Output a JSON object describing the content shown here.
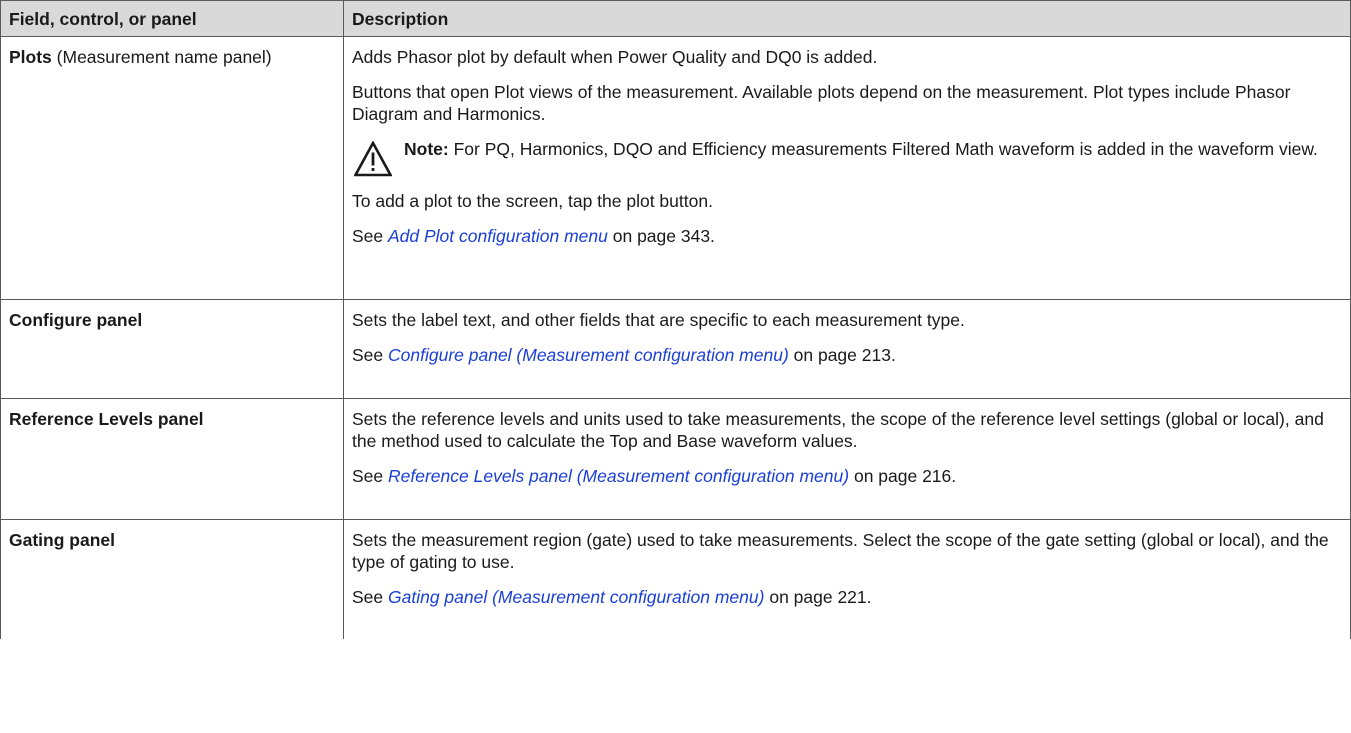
{
  "table": {
    "headers": [
      "Field, control, or panel",
      "Description"
    ],
    "rows": [
      {
        "field_bold": "Plots",
        "field_rest": " (Measurement name panel)",
        "paragraphs": [
          "Adds Phasor plot by default when Power Quality and DQ0 is added.",
          "Buttons that open Plot views of the measurement. Available plots depend on the measurement. Plot types include Phasor Diagram and Harmonics."
        ],
        "note": {
          "label": "Note:",
          "text": " For PQ, Harmonics, DQO and Efficiency measurements Filtered Math waveform is added in the waveform view."
        },
        "paragraphs_after": [
          "To add a plot to the screen, tap the plot button."
        ],
        "see": {
          "prefix": "See ",
          "link": "Add Plot configuration menu",
          "suffix": " on page 343."
        }
      },
      {
        "field_bold": "Configure panel",
        "paragraphs": [
          "Sets the label text, and other fields that are specific to each measurement type."
        ],
        "see": {
          "prefix": "See ",
          "link": "Configure panel (Measurement configuration menu)",
          "suffix": " on page 213."
        }
      },
      {
        "field_bold": "Reference Levels panel",
        "paragraphs": [
          "Sets the reference levels and units used to take measurements, the scope of the reference level settings (global or local), and the method used to calculate the Top and Base waveform values."
        ],
        "see": {
          "prefix": "See ",
          "link": "Reference Levels panel (Measurement configuration menu)",
          "suffix": " on page 216."
        }
      },
      {
        "field_bold": "Gating panel",
        "paragraphs": [
          "Sets the measurement region (gate) used to take measurements. Select the scope of the gate setting (global or local), and the type of gating to use."
        ],
        "see": {
          "prefix": "See ",
          "link": "Gating panel (Measurement configuration menu)",
          "suffix": " on page 221."
        }
      }
    ]
  },
  "icons": {
    "note": "warning-triangle-icon"
  },
  "colors": {
    "link": "#1a3fd6",
    "header_bg": "#d9d9d9",
    "border": "#5a5a5a"
  }
}
